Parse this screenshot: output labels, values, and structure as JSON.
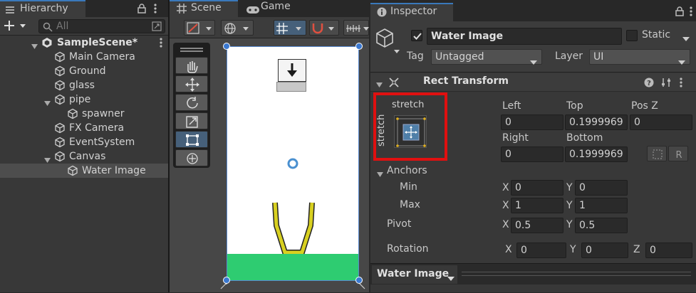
{
  "hierarchy": {
    "title": "Hierarchy",
    "search_placeholder": "All",
    "scene_name": "SampleScene*",
    "items": [
      {
        "label": "Main Camera",
        "depth": 1
      },
      {
        "label": "Ground",
        "depth": 1
      },
      {
        "label": "glass",
        "depth": 1
      },
      {
        "label": "pipe",
        "depth": 1
      },
      {
        "label": "spawner",
        "depth": 2
      },
      {
        "label": "FX Camera",
        "depth": 1
      },
      {
        "label": "EventSystem",
        "depth": 1
      },
      {
        "label": "Canvas",
        "depth": 1
      },
      {
        "label": "Water Image",
        "depth": 2,
        "selected": true
      }
    ]
  },
  "scene": {
    "tab_scene": "Scene",
    "tab_game": "Game"
  },
  "inspector": {
    "title": "Inspector",
    "object_name": "Water Image",
    "static_label": "Static",
    "tag_label": "Tag",
    "tag_value": "Untagged",
    "layer_label": "Layer",
    "layer_value": "UI",
    "component": "Rect Transform",
    "anchor_preset_top": "stretch",
    "anchor_preset_side": "stretch",
    "fields": {
      "left_label": "Left",
      "left": "0",
      "top_label": "Top",
      "top": "0.1999969",
      "posz_label": "Pos Z",
      "posz": "0",
      "right_label": "Right",
      "right": "0",
      "bottom_label": "Bottom",
      "bottom": "0.1999969"
    },
    "anchors_label": "Anchors",
    "min_label": "Min",
    "min_x": "0",
    "min_y": "0",
    "max_label": "Max",
    "max_x": "1",
    "max_y": "1",
    "pivot_label": "Pivot",
    "pivot_x": "0.5",
    "pivot_y": "0.5",
    "rotation_label": "Rotation",
    "rot_x": "0",
    "rot_y": "0",
    "rot_z": "0",
    "axis_x": "X",
    "axis_y": "Y",
    "axis_z": "Z",
    "footer_label": "Water Image"
  }
}
